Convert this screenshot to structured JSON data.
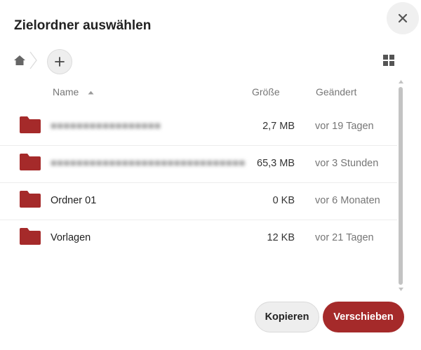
{
  "dialog": {
    "title": "Zielordner auswählen",
    "close_icon": "close-icon"
  },
  "breadcrumb": {
    "home_icon": "home-icon",
    "new_folder_icon": "plus-icon"
  },
  "view_toggle_icon": "grid-view-icon",
  "columns": {
    "name": "Name",
    "size": "Größe",
    "modified": "Geändert"
  },
  "rows": [
    {
      "name": "■■■■■■■■■■■■■■■■■",
      "blurred": true,
      "size": "2,7 MB",
      "modified": "vor 19 Tagen"
    },
    {
      "name": "■■■■■■■■■■■■■■■■■■■■■■■■■■■■■■",
      "blurred": true,
      "size": "65,3 MB",
      "modified": "vor 3 Stunden"
    },
    {
      "name": "Ordner 01",
      "blurred": false,
      "size": "0 KB",
      "modified": "vor 6 Monaten"
    },
    {
      "name": "Vorlagen",
      "blurred": false,
      "size": "12 KB",
      "modified": "vor 21 Tagen"
    }
  ],
  "buttons": {
    "copy": "Kopieren",
    "move": "Verschieben"
  },
  "colors": {
    "folder": "#a52a2a",
    "primary": "#a52a2a",
    "secondary_bg": "#eeeeee",
    "muted_text": "#767676"
  }
}
